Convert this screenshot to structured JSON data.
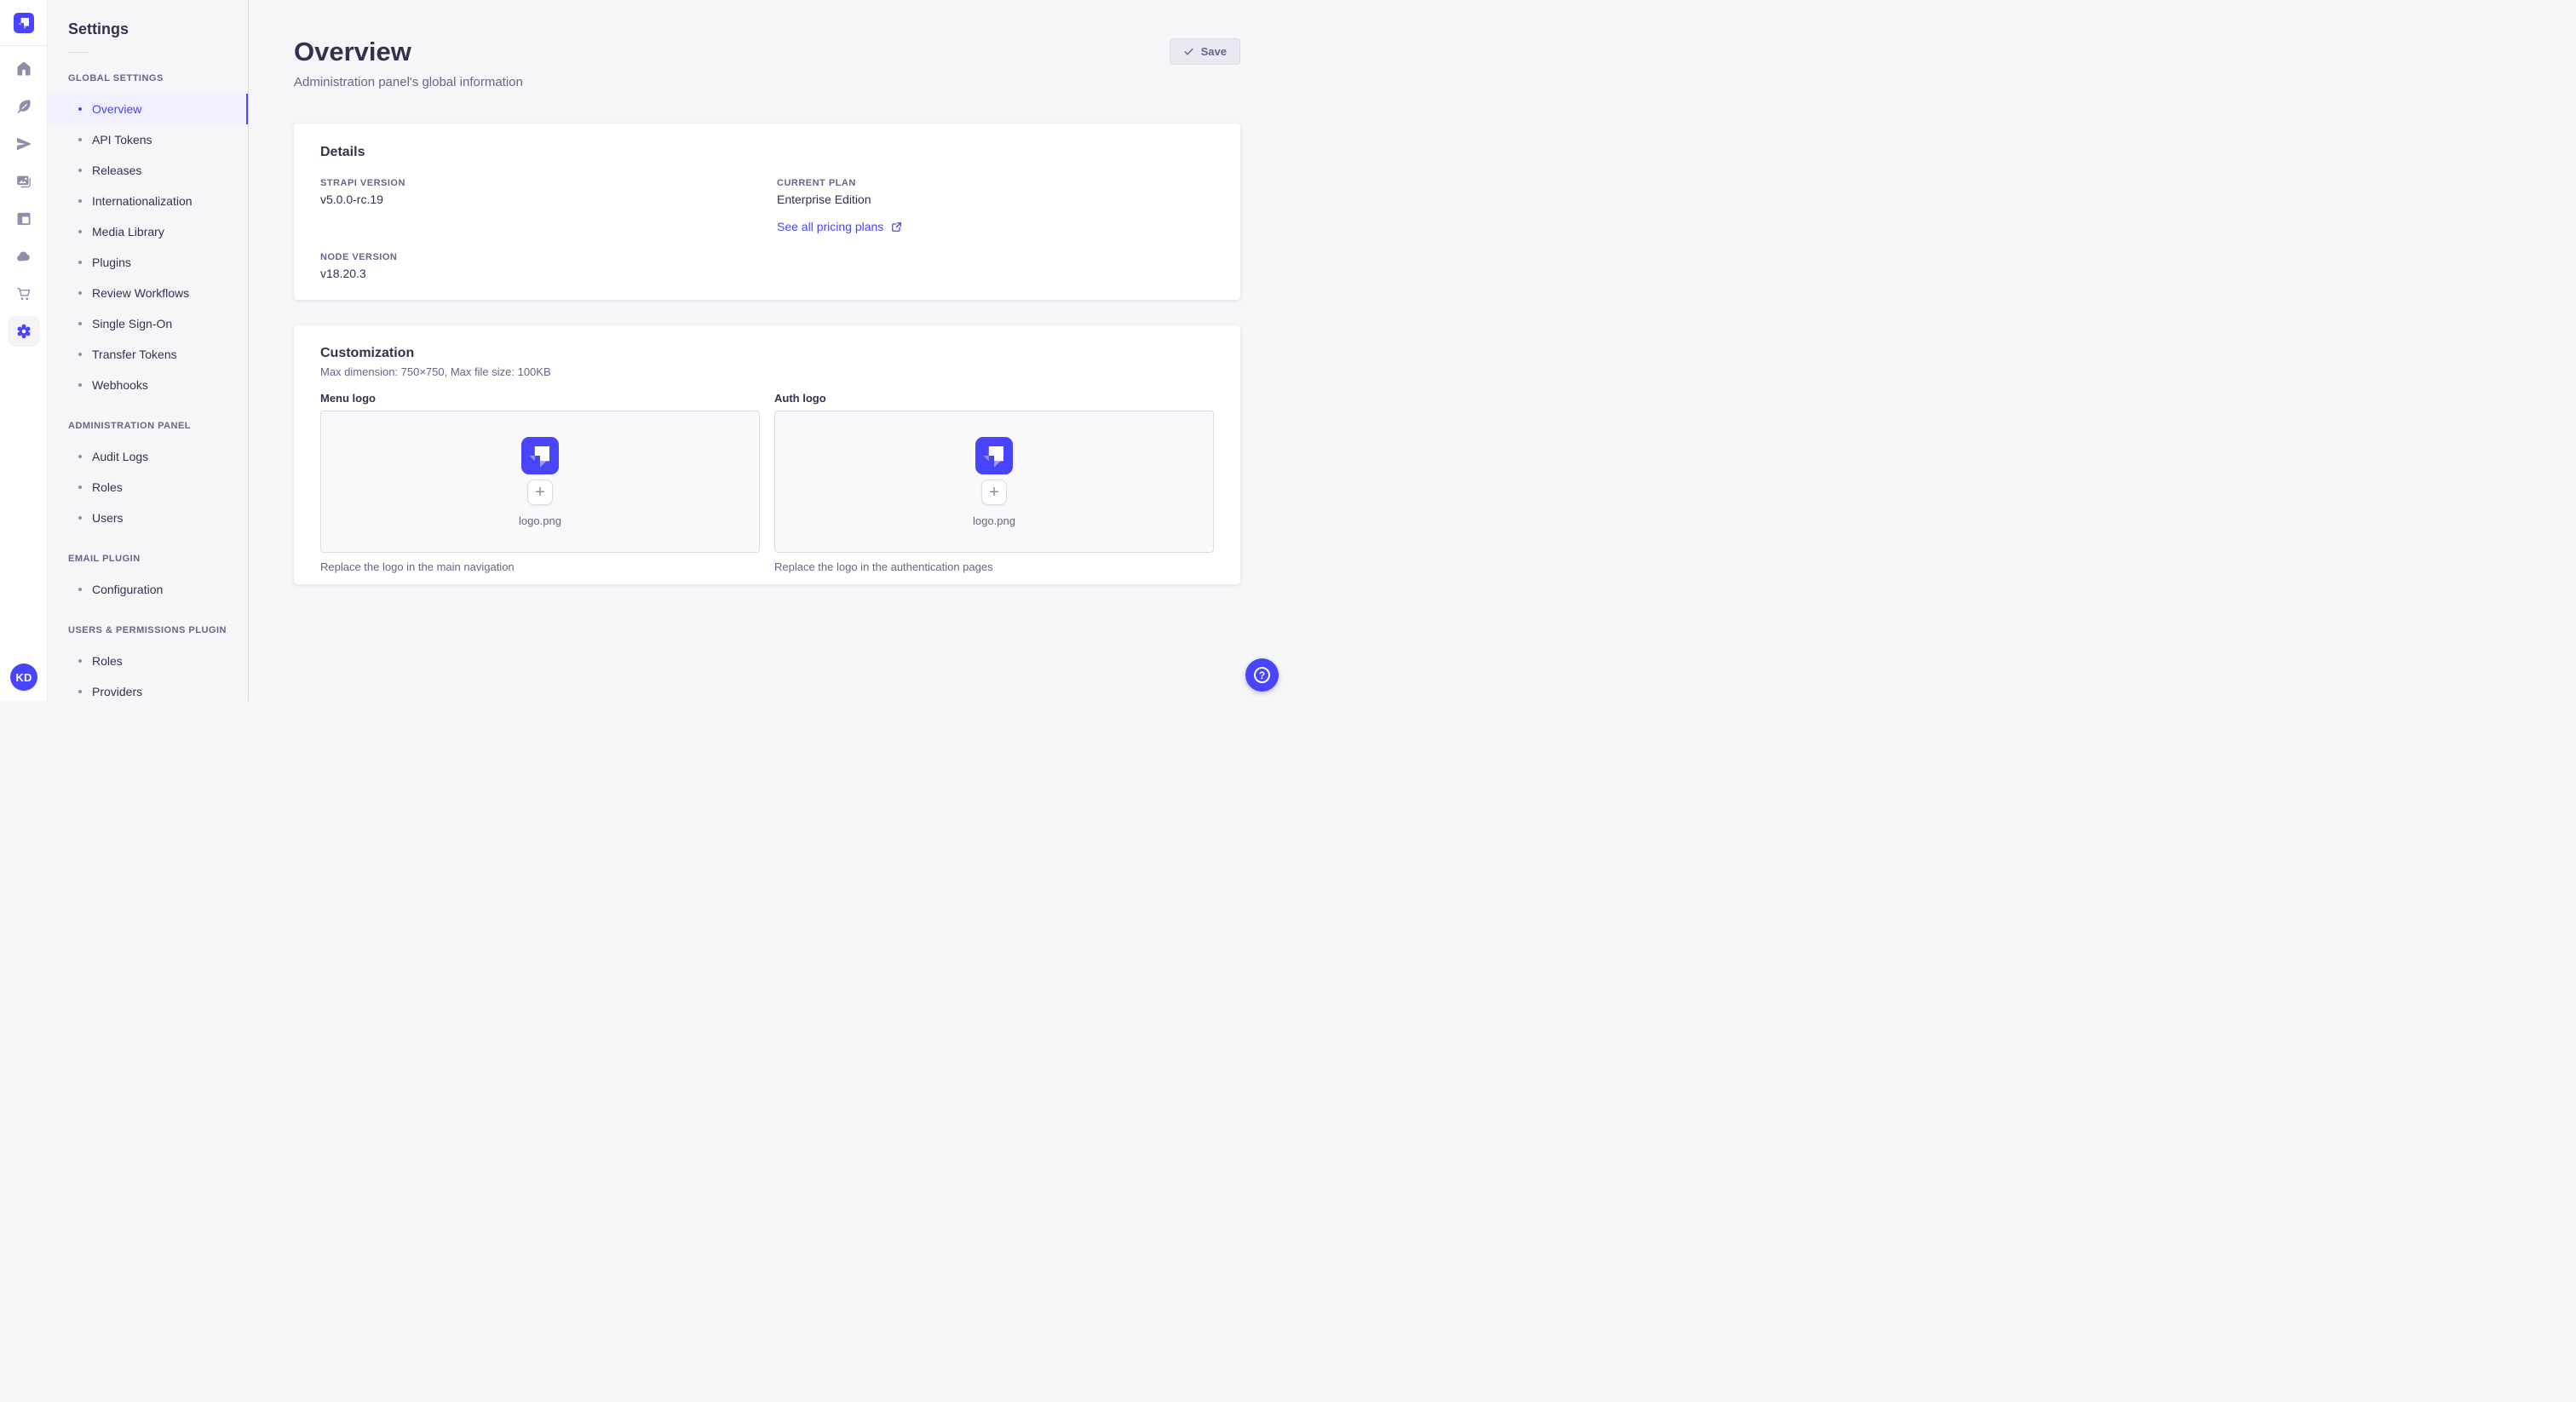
{
  "brand": {
    "accent": "#4945ff",
    "active_bg": "#f0f0ff",
    "text_dark": "#32324d",
    "text_muted": "#666687"
  },
  "rail": {
    "logo_icon": "strapi-logo",
    "icons": [
      "home",
      "feather",
      "paper-plane",
      "images",
      "layout",
      "cloud",
      "shopping-cart",
      "gear"
    ],
    "active_icon": "gear",
    "avatar_initials": "KD"
  },
  "subnav": {
    "title": "Settings",
    "sections": [
      {
        "label": "GLOBAL SETTINGS",
        "items": [
          {
            "label": "Overview",
            "active": true
          },
          {
            "label": "API Tokens"
          },
          {
            "label": "Releases"
          },
          {
            "label": "Internationalization"
          },
          {
            "label": "Media Library"
          },
          {
            "label": "Plugins"
          },
          {
            "label": "Review Workflows"
          },
          {
            "label": "Single Sign-On"
          },
          {
            "label": "Transfer Tokens"
          },
          {
            "label": "Webhooks"
          }
        ]
      },
      {
        "label": "ADMINISTRATION PANEL",
        "items": [
          {
            "label": "Audit Logs"
          },
          {
            "label": "Roles"
          },
          {
            "label": "Users"
          }
        ]
      },
      {
        "label": "EMAIL PLUGIN",
        "items": [
          {
            "label": "Configuration"
          }
        ]
      },
      {
        "label": "USERS & PERMISSIONS PLUGIN",
        "items": [
          {
            "label": "Roles"
          },
          {
            "label": "Providers"
          }
        ]
      }
    ]
  },
  "header": {
    "title": "Overview",
    "subtitle": "Administration panel's global information",
    "save_label": "Save"
  },
  "details": {
    "heading": "Details",
    "strapi_version": {
      "label": "STRAPI VERSION",
      "value": "v5.0.0-rc.19"
    },
    "current_plan": {
      "label": "CURRENT PLAN",
      "value": "Enterprise Edition"
    },
    "node_version": {
      "label": "NODE VERSION",
      "value": "v18.20.3"
    },
    "pricing_link": {
      "label": "See all pricing plans",
      "icon": "external-link"
    }
  },
  "customization": {
    "heading": "Customization",
    "subtitle": "Max dimension: 750×750, Max file size: 100KB",
    "uploads": [
      {
        "label": "Menu logo",
        "filename": "logo.png",
        "caption": "Replace the logo in the main navigation"
      },
      {
        "label": "Auth logo",
        "filename": "logo.png",
        "caption": "Replace the logo in the authentication pages"
      }
    ],
    "plus_glyph": "+"
  },
  "help": {
    "glyph": "?"
  }
}
